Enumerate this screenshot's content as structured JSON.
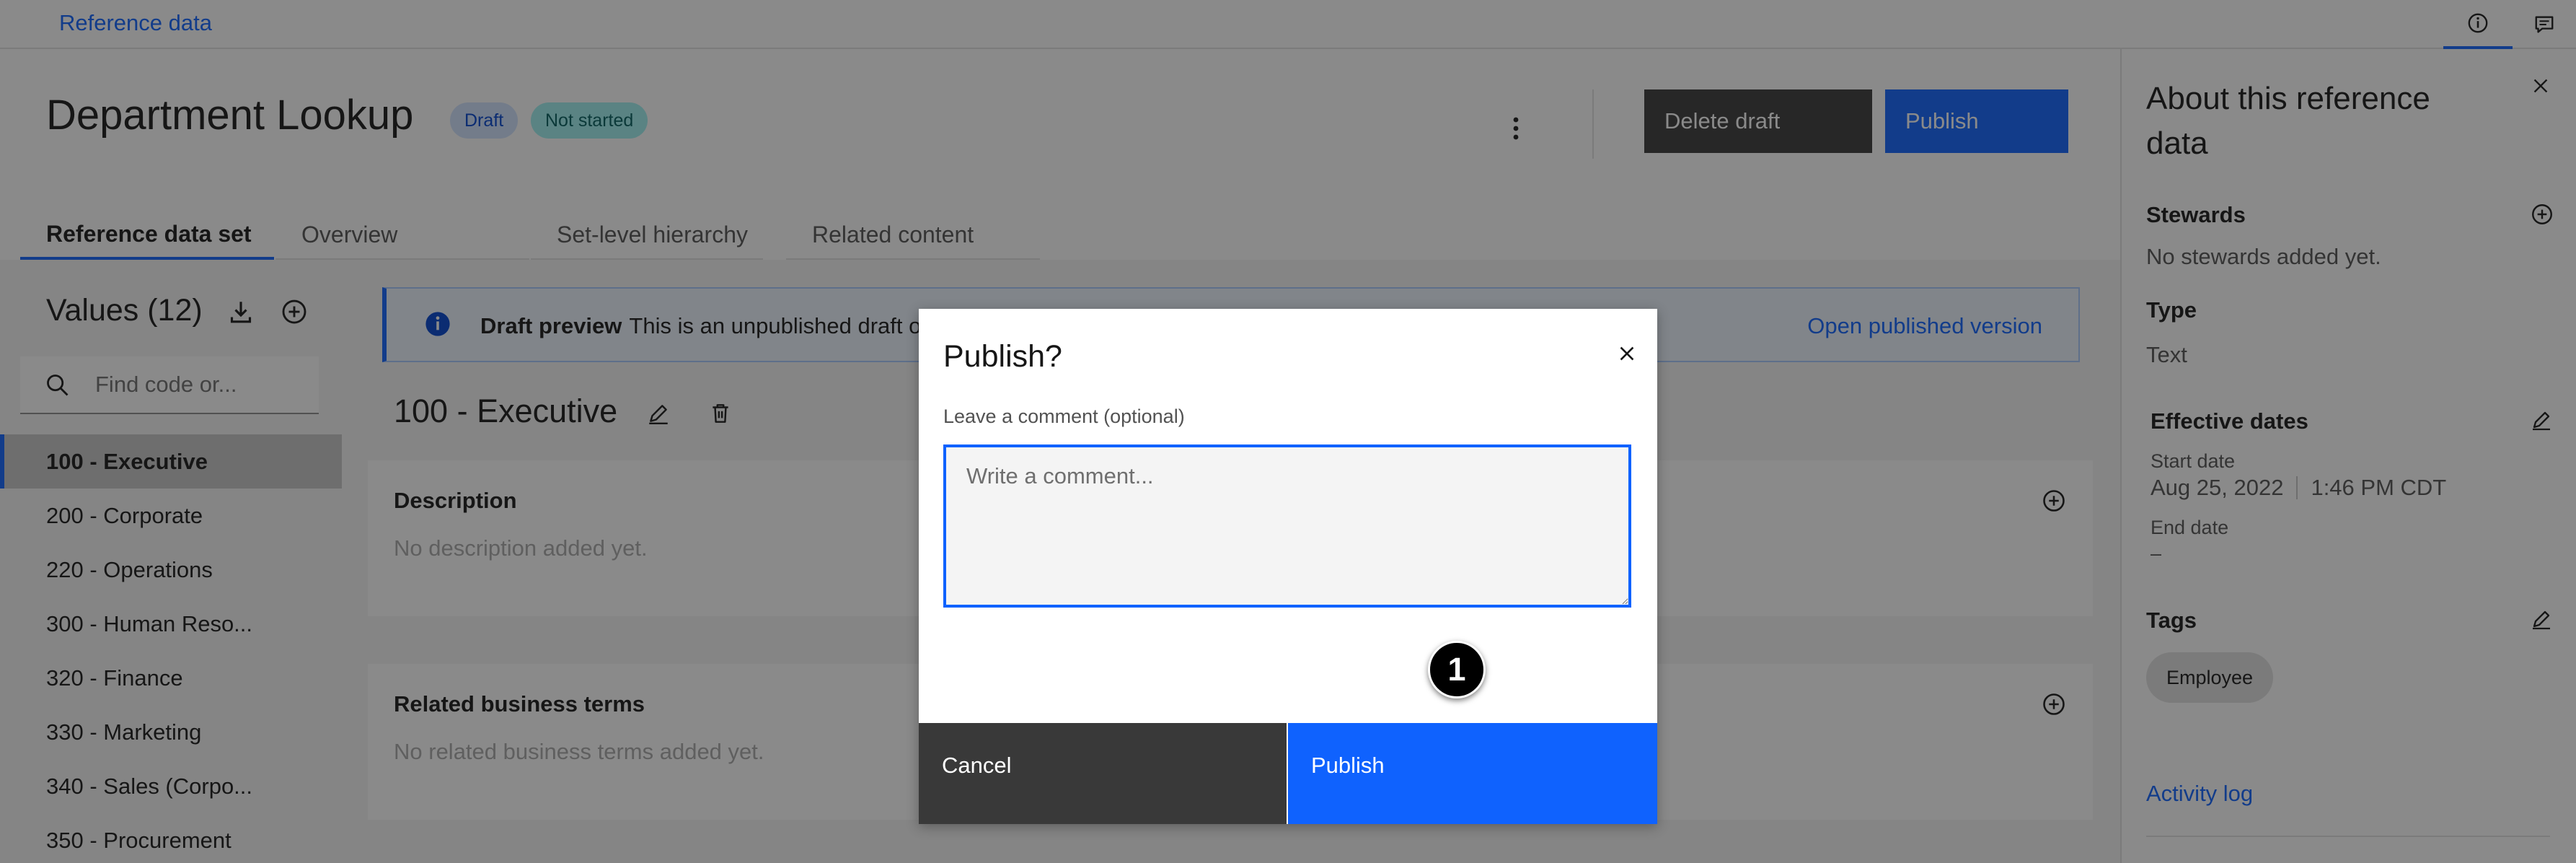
{
  "topbar": {
    "breadcrumb": "Reference data"
  },
  "header": {
    "title": "Department Lookup",
    "tag_draft": "Draft",
    "tag_status": "Not started",
    "delete_draft_label": "Delete draft",
    "publish_label": "Publish"
  },
  "tabs": [
    {
      "label": "Reference data set"
    },
    {
      "label": "Overview"
    },
    {
      "label": "Set-level hierarchy"
    },
    {
      "label": "Related content"
    }
  ],
  "left_panel": {
    "title": "Values (12)",
    "search_placeholder": "Find code or...",
    "items": [
      {
        "label": "100 - Executive"
      },
      {
        "label": "200 - Corporate"
      },
      {
        "label": "220 - Operations"
      },
      {
        "label": "300 - Human Reso..."
      },
      {
        "label": "320 - Finance"
      },
      {
        "label": "330 - Marketing"
      },
      {
        "label": "340 - Sales (Corpo..."
      },
      {
        "label": "350 - Procurement"
      }
    ]
  },
  "main": {
    "notification_title": "Draft preview",
    "notification_text": "This is an unpublished draft of",
    "open_published_label": "Open published version",
    "value_heading": "100 - Executive",
    "description_title": "Description",
    "description_empty": "No description added yet.",
    "terms_title": "Related business terms",
    "terms_empty": "No related business terms added yet."
  },
  "right_panel": {
    "title": "About this reference data",
    "stewards_label": "Stewards",
    "stewards_empty": "No stewards added yet.",
    "type_label": "Type",
    "type_value": "Text",
    "effective_dates_label": "Effective dates",
    "start_date_label": "Start date",
    "start_date": "Aug 25, 2022",
    "start_time": "1:46 PM CDT",
    "end_date_label": "End date",
    "end_date": "–",
    "tags_label": "Tags",
    "tag": "Employee",
    "activity_log": "Activity log"
  },
  "modal": {
    "title": "Publish?",
    "comment_label": "Leave a comment (optional)",
    "comment_placeholder": "Write a comment...",
    "step_badge": "1",
    "cancel_label": "Cancel",
    "publish_label": "Publish"
  }
}
